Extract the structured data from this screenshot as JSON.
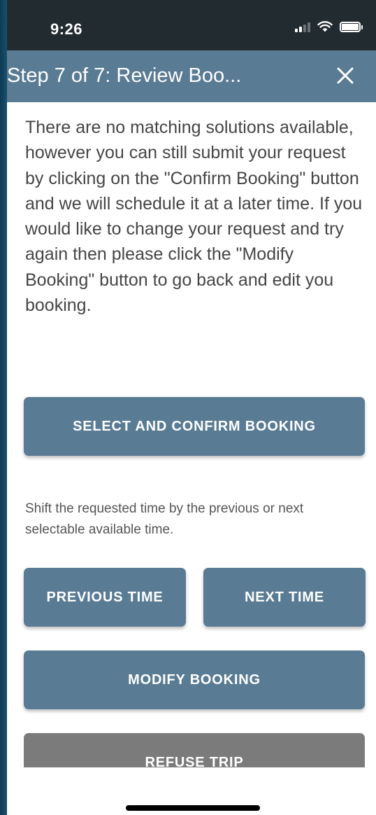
{
  "status_bar": {
    "time": "9:26",
    "icons": [
      "cellular-signal-icon",
      "wifi-icon",
      "battery-icon"
    ]
  },
  "header": {
    "title": "Step 7 of 7: Review Boo...",
    "close_icon": "close-icon"
  },
  "message": "There are no matching solutions available, however you can still submit your request by clicking on the \"Confirm Booking\" button and we will schedule it at a later time. If you would like to change your request and try again then please click the \"Modify Booking\" button to go back and edit you booking.",
  "buttons": {
    "confirm": "SELECT AND CONFIRM BOOKING",
    "previous_time": "PREVIOUS TIME",
    "next_time": "NEXT TIME",
    "modify": "MODIFY BOOKING",
    "refuse": "REFUSE TRIP"
  },
  "hint": "Shift the requested time by the previous or next selectable available time.",
  "colors": {
    "header_bg": "#5a7b94",
    "primary_button": "#5a7b94",
    "refuse_button": "#7b7b7b",
    "status_bar_bg": "#222b30",
    "body_text": "#454545"
  }
}
